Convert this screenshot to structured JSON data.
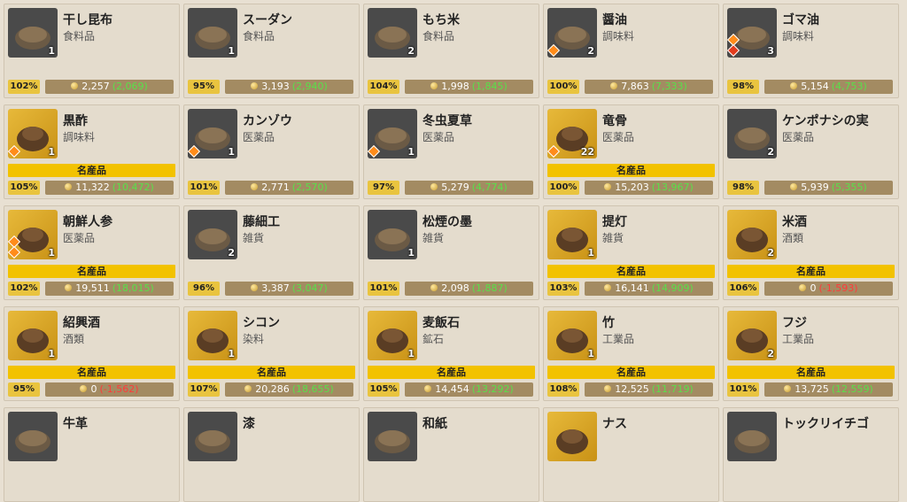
{
  "items": [
    {
      "name": "干し昆布",
      "category": "食料品",
      "qty": "1",
      "pct": "102%",
      "price": "2,257",
      "diff": "(2,069)",
      "diff_type": "up",
      "meisan": "",
      "thumb": "dark",
      "icon": "dried-kelp-icon",
      "badges": []
    },
    {
      "name": "スーダン",
      "category": "食料品",
      "qty": "1",
      "pct": "95%",
      "price": "3,193",
      "diff": "(2,940)",
      "diff_type": "up",
      "meisan": "",
      "thumb": "dark",
      "icon": "sudan-bowl-icon",
      "badges": []
    },
    {
      "name": "もち米",
      "category": "食料品",
      "qty": "2",
      "pct": "104%",
      "price": "1,998",
      "diff": "(1,845)",
      "diff_type": "up",
      "meisan": "",
      "thumb": "dark",
      "icon": "rice-box-icon",
      "badges": []
    },
    {
      "name": "醤油",
      "category": "調味料",
      "qty": "2",
      "pct": "100%",
      "price": "7,863",
      "diff": "(7,333)",
      "diff_type": "up",
      "meisan": "",
      "thumb": "dark",
      "icon": "soy-sauce-bottle-icon",
      "badges": [
        "orange"
      ]
    },
    {
      "name": "ゴマ油",
      "category": "調味料",
      "qty": "3",
      "pct": "98%",
      "price": "5,154",
      "diff": "(4,753)",
      "diff_type": "up",
      "meisan": "",
      "thumb": "dark",
      "icon": "sesame-oil-jar-icon",
      "badges": [
        "orange",
        "red"
      ]
    },
    {
      "name": "黒酢",
      "category": "調味料",
      "qty": "1",
      "pct": "105%",
      "price": "11,322",
      "diff": "(10,472)",
      "diff_type": "up",
      "meisan": "名産品",
      "thumb": "gold",
      "icon": "black-vinegar-jar-icon",
      "badges": [
        "orange"
      ]
    },
    {
      "name": "カンゾウ",
      "category": "医薬品",
      "qty": "1",
      "pct": "101%",
      "price": "2,771",
      "diff": "(2,570)",
      "diff_type": "up",
      "meisan": "",
      "thumb": "dark",
      "icon": "licorice-root-icon",
      "badges": [
        "orange"
      ]
    },
    {
      "name": "冬虫夏草",
      "category": "医薬品",
      "qty": "1",
      "pct": "97%",
      "price": "5,279",
      "diff": "(4,774)",
      "diff_type": "up",
      "meisan": "",
      "thumb": "dark",
      "icon": "cordyceps-icon",
      "badges": [
        "orange"
      ]
    },
    {
      "name": "竜骨",
      "category": "医薬品",
      "qty": "22",
      "pct": "100%",
      "price": "15,203",
      "diff": "(13,967)",
      "diff_type": "up",
      "meisan": "名産品",
      "thumb": "gold",
      "icon": "dragon-bone-icon",
      "badges": [
        "orange"
      ]
    },
    {
      "name": "ケンポナシの実",
      "category": "医薬品",
      "qty": "2",
      "pct": "98%",
      "price": "5,939",
      "diff": "(5,355)",
      "diff_type": "up",
      "meisan": "",
      "thumb": "dark",
      "icon": "raisin-tree-fruit-icon",
      "badges": []
    },
    {
      "name": "朝鮮人参",
      "category": "医薬品",
      "qty": "1",
      "pct": "102%",
      "price": "19,511",
      "diff": "(18,015)",
      "diff_type": "up",
      "meisan": "名産品",
      "thumb": "gold",
      "icon": "ginseng-icon",
      "badges": [
        "orange",
        "orange"
      ]
    },
    {
      "name": "藤細工",
      "category": "雑貨",
      "qty": "2",
      "pct": "96%",
      "price": "3,387",
      "diff": "(3,047)",
      "diff_type": "up",
      "meisan": "",
      "thumb": "dark",
      "icon": "rattan-basket-icon",
      "badges": []
    },
    {
      "name": "松煙の墨",
      "category": "雑貨",
      "qty": "1",
      "pct": "101%",
      "price": "2,098",
      "diff": "(1,887)",
      "diff_type": "up",
      "meisan": "",
      "thumb": "dark",
      "icon": "ink-stick-icon",
      "badges": []
    },
    {
      "name": "提灯",
      "category": "雑貨",
      "qty": "1",
      "pct": "103%",
      "price": "16,141",
      "diff": "(14,909)",
      "diff_type": "up",
      "meisan": "名産品",
      "thumb": "gold",
      "icon": "lantern-icon",
      "badges": []
    },
    {
      "name": "米酒",
      "category": "酒類",
      "qty": "2",
      "pct": "106%",
      "price": "0",
      "diff": "(-1,593)",
      "diff_type": "down",
      "meisan": "名産品",
      "thumb": "gold",
      "icon": "rice-wine-icon",
      "badges": []
    },
    {
      "name": "紹興酒",
      "category": "酒類",
      "qty": "1",
      "pct": "95%",
      "price": "0",
      "diff": "(-1,562)",
      "diff_type": "down",
      "meisan": "名産品",
      "thumb": "gold",
      "icon": "shaoxing-wine-jar-icon",
      "badges": []
    },
    {
      "name": "シコン",
      "category": "染料",
      "qty": "1",
      "pct": "107%",
      "price": "20,286",
      "diff": "(18,655)",
      "diff_type": "up",
      "meisan": "名産品",
      "thumb": "gold",
      "icon": "gromwell-root-icon",
      "badges": []
    },
    {
      "name": "麦飯石",
      "category": "鉱石",
      "qty": "1",
      "pct": "105%",
      "price": "14,454",
      "diff": "(13,292)",
      "diff_type": "up",
      "meisan": "名産品",
      "thumb": "gold",
      "icon": "maifan-stone-icon",
      "badges": []
    },
    {
      "name": "竹",
      "category": "工業品",
      "qty": "1",
      "pct": "108%",
      "price": "12,525",
      "diff": "(11,719)",
      "diff_type": "up",
      "meisan": "名産品",
      "thumb": "gold",
      "icon": "bamboo-icon",
      "badges": []
    },
    {
      "name": "フジ",
      "category": "工業品",
      "qty": "2",
      "pct": "101%",
      "price": "13,725",
      "diff": "(12,559)",
      "diff_type": "up",
      "meisan": "名産品",
      "thumb": "gold",
      "icon": "wisteria-bundle-icon",
      "badges": []
    },
    {
      "name": "牛革",
      "category": "",
      "qty": "",
      "pct": "",
      "price": "",
      "diff": "",
      "diff_type": "up",
      "meisan": "",
      "thumb": "dark",
      "icon": "cowhide-icon",
      "badges": []
    },
    {
      "name": "漆",
      "category": "",
      "qty": "",
      "pct": "",
      "price": "",
      "diff": "",
      "diff_type": "up",
      "meisan": "",
      "thumb": "dark",
      "icon": "lacquer-icon",
      "badges": []
    },
    {
      "name": "和紙",
      "category": "",
      "qty": "",
      "pct": "",
      "price": "",
      "diff": "",
      "diff_type": "up",
      "meisan": "",
      "thumb": "dark",
      "icon": "washi-paper-icon",
      "badges": []
    },
    {
      "name": "ナス",
      "category": "",
      "qty": "",
      "pct": "",
      "price": "",
      "diff": "",
      "diff_type": "up",
      "meisan": "",
      "thumb": "gold",
      "icon": "eggplant-icon",
      "badges": []
    },
    {
      "name": "トックリイチゴ",
      "category": "",
      "qty": "",
      "pct": "",
      "price": "",
      "diff": "",
      "diff_type": "up",
      "meisan": "",
      "thumb": "dark",
      "icon": "raspberry-icon",
      "badges": []
    }
  ],
  "colors": {
    "meisan_banner": "#f2c200",
    "price_up": "#59e04a",
    "price_down": "#ff3b3b",
    "price_bar": "#a38b62",
    "pct_badge": "#e9c43f"
  }
}
